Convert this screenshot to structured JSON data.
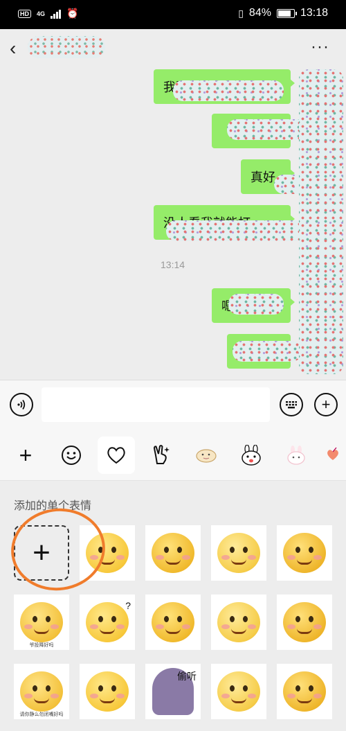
{
  "status_bar": {
    "hd": "HD",
    "network": "4G",
    "battery_text": "84%",
    "battery_level": 0.84,
    "time": "13:18"
  },
  "nav": {
    "more_label": "···"
  },
  "chat": {
    "time_label": "13:14",
    "messages": [
      {
        "text": "我要"
      },
      {
        "text": ""
      },
      {
        "text": "真好"
      },
      {
        "text": "没人看我就能打"
      },
      {
        "text": "嗯"
      },
      {
        "text": ""
      }
    ]
  },
  "emoji_tabs": [
    {
      "icon": "plus-icon"
    },
    {
      "icon": "smile-icon"
    },
    {
      "icon": "heart-icon"
    },
    {
      "icon": "victory-hand-icon"
    },
    {
      "icon": "sticker-pack-icon"
    },
    {
      "icon": "rabbit-sticker-icon"
    },
    {
      "icon": "bunny-sticker-icon"
    },
    {
      "icon": "heart-sticker-icon"
    }
  ],
  "panel": {
    "title": "添加的单个表情",
    "stickers": [
      {
        "caption": "",
        "overlay": ""
      },
      {
        "caption": "",
        "overlay": ""
      },
      {
        "caption": "",
        "overlay": ""
      },
      {
        "caption": "",
        "overlay": ""
      },
      {
        "caption": "爷投降好吗",
        "overlay": ""
      },
      {
        "caption": "",
        "overlay": "?"
      },
      {
        "caption": "",
        "overlay": ""
      },
      {
        "caption": "",
        "overlay": ""
      },
      {
        "caption": "",
        "overlay": ""
      },
      {
        "caption": "请你静么勿闭嘴好吗",
        "overlay": ""
      },
      {
        "caption": "",
        "overlay": ""
      },
      {
        "caption": "",
        "overlay": "偷听"
      },
      {
        "caption": "",
        "overlay": ""
      },
      {
        "caption": "",
        "overlay": ""
      }
    ]
  }
}
